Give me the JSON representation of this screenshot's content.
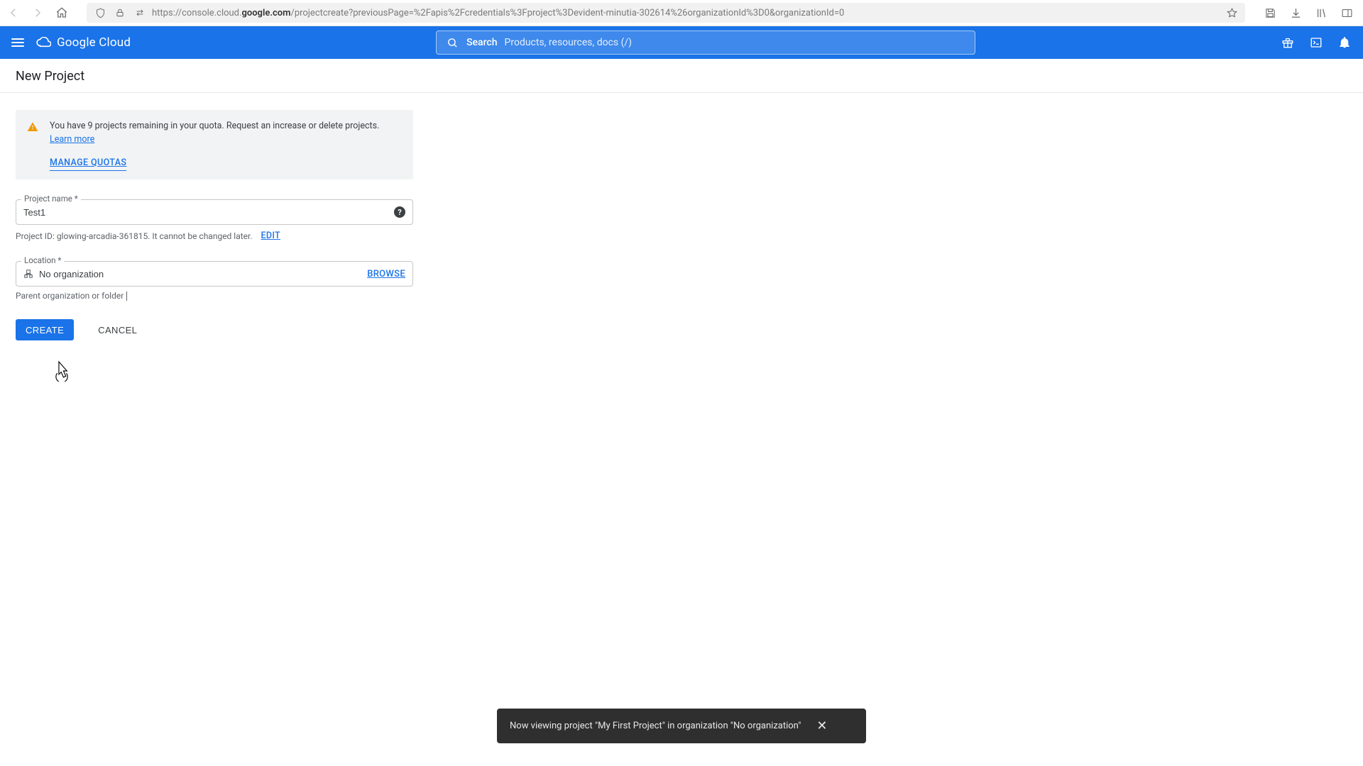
{
  "browser": {
    "url_prefix": "https://console.cloud.",
    "url_bold": "google.com",
    "url_suffix": "/projectcreate?previousPage=%2Fapis%2Fcredentials%3Fproject%3Devident-minutia-302614%26organizationId%3D0&organizationId=0"
  },
  "header": {
    "brand": "Google Cloud",
    "search_label": "Search",
    "search_placeholder": "Products, resources, docs (/)"
  },
  "page": {
    "title": "New Project"
  },
  "alert": {
    "text_before": "You have 9 projects remaining in your quota. Request an increase or delete projects. ",
    "learn_more": "Learn more",
    "manage_quotas": "MANAGE QUOTAS"
  },
  "form": {
    "project_name_label": "Project name *",
    "project_name_value": "Test1",
    "project_id_label": "Project ID:",
    "project_id_value": "glowing-arcadia-361815",
    "project_id_note": ". It cannot be changed later.",
    "edit_label": "EDIT",
    "location_label": "Location *",
    "location_value": "No organization",
    "browse_label": "BROWSE",
    "location_helper": "Parent organization or folder"
  },
  "buttons": {
    "create": "CREATE",
    "cancel": "CANCEL"
  },
  "toast": {
    "message": "Now viewing project \"My First Project\" in organization \"No organization\""
  }
}
